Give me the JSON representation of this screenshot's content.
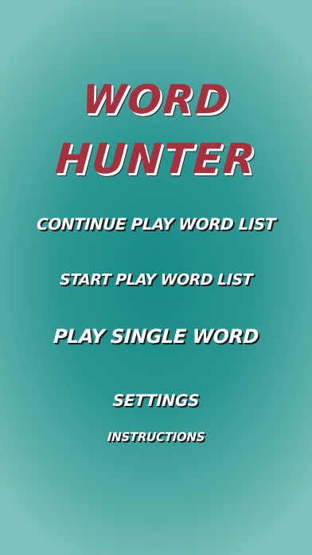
{
  "app": {
    "title_line1": "WORD",
    "title_line2": "HUNTER"
  },
  "menu": {
    "continue_label": "CONTINUE PLAY WORD LIST",
    "start_label": "START PLAY WORD LIST",
    "single_label": "PLAY SINGLE WORD",
    "settings_label": "SETTINGS",
    "instructions_label": "INSTRUCTIONS"
  },
  "colors": {
    "background": "#2c9792",
    "title": "#a8303d",
    "menu_text": "#ffffff"
  }
}
